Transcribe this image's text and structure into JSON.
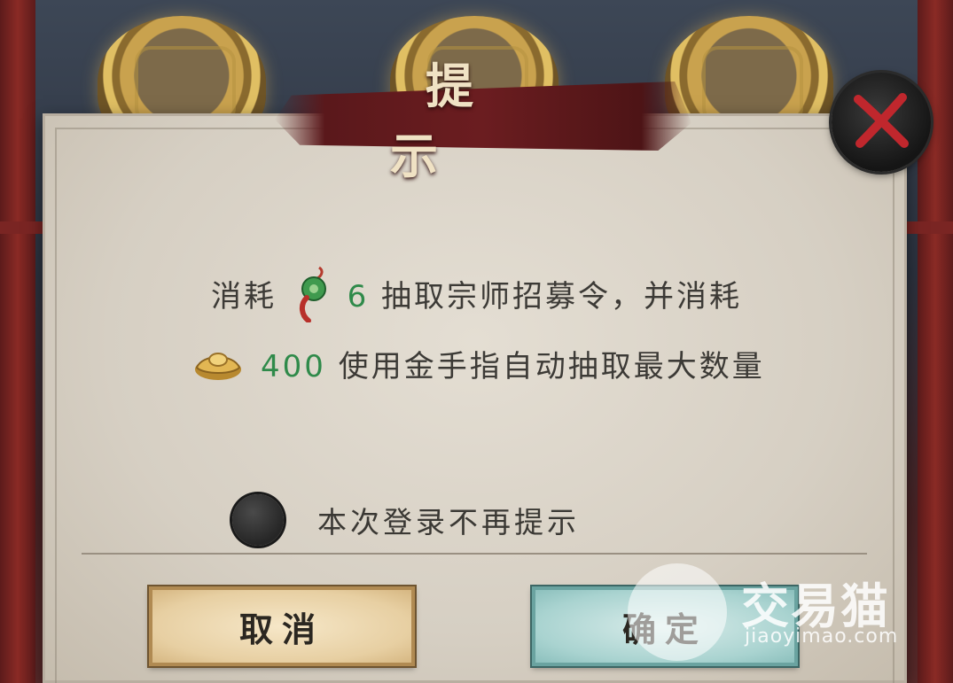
{
  "dialog": {
    "title": "提 示",
    "message_line1": {
      "prefix": "消耗",
      "item_icon": "jade-token-icon",
      "amount": "6",
      "suffix": "抽取宗师招募令，并消耗"
    },
    "message_line2": {
      "currency_icon": "gold-ingot-icon",
      "amount": "400",
      "suffix": "使用金手指自动抽取最大数量"
    },
    "checkbox_label": "本次登录不再提示",
    "cancel_label": "取消",
    "confirm_label": "确定",
    "close_icon": "close-x-icon"
  },
  "watermark": {
    "brand": "交易猫",
    "url": "jiaoyimao.com"
  },
  "colors": {
    "title_banner": "#5a181b",
    "amount_text": "#2f8a4a",
    "close_x": "#c0272d",
    "cancel_bg": "#e7cfa2",
    "confirm_bg": "#a9d3d0"
  }
}
